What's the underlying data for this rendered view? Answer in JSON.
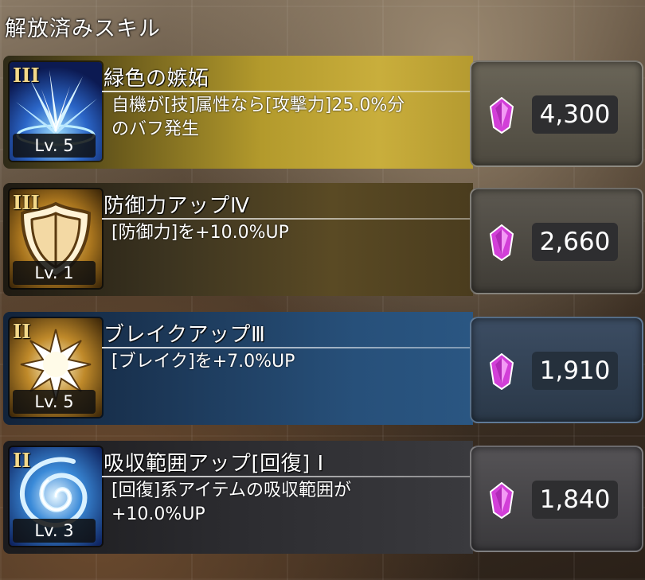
{
  "title": "解放済みスキル",
  "skills": [
    {
      "rank": "III",
      "name": "緑色の嫉妬",
      "description": "自機が[技]属性なら[攻撃力]25.0%分\nのバフ発生",
      "level": "Lv. 5",
      "price": "4,300",
      "icon": "ice-burst-icon"
    },
    {
      "rank": "III",
      "name": "防御力アップⅣ",
      "description": "[防御力]を+10.0%UP",
      "level": "Lv. 1",
      "price": "2,660",
      "icon": "shield-icon"
    },
    {
      "rank": "II",
      "name": "ブレイクアップⅢ",
      "description": "[ブレイク]を+7.0%UP",
      "level": "Lv. 5",
      "price": "1,910",
      "icon": "starburst-icon"
    },
    {
      "rank": "II",
      "name": "吸収範囲アップ[回復] Ⅰ",
      "description": "[回復]系アイテムの吸収範囲が\n+10.0%UP",
      "level": "Lv. 3",
      "price": "1,840",
      "icon": "vortex-icon"
    }
  ],
  "colors": {
    "gem": "#d23fd8",
    "rank": "#f4d98a"
  }
}
